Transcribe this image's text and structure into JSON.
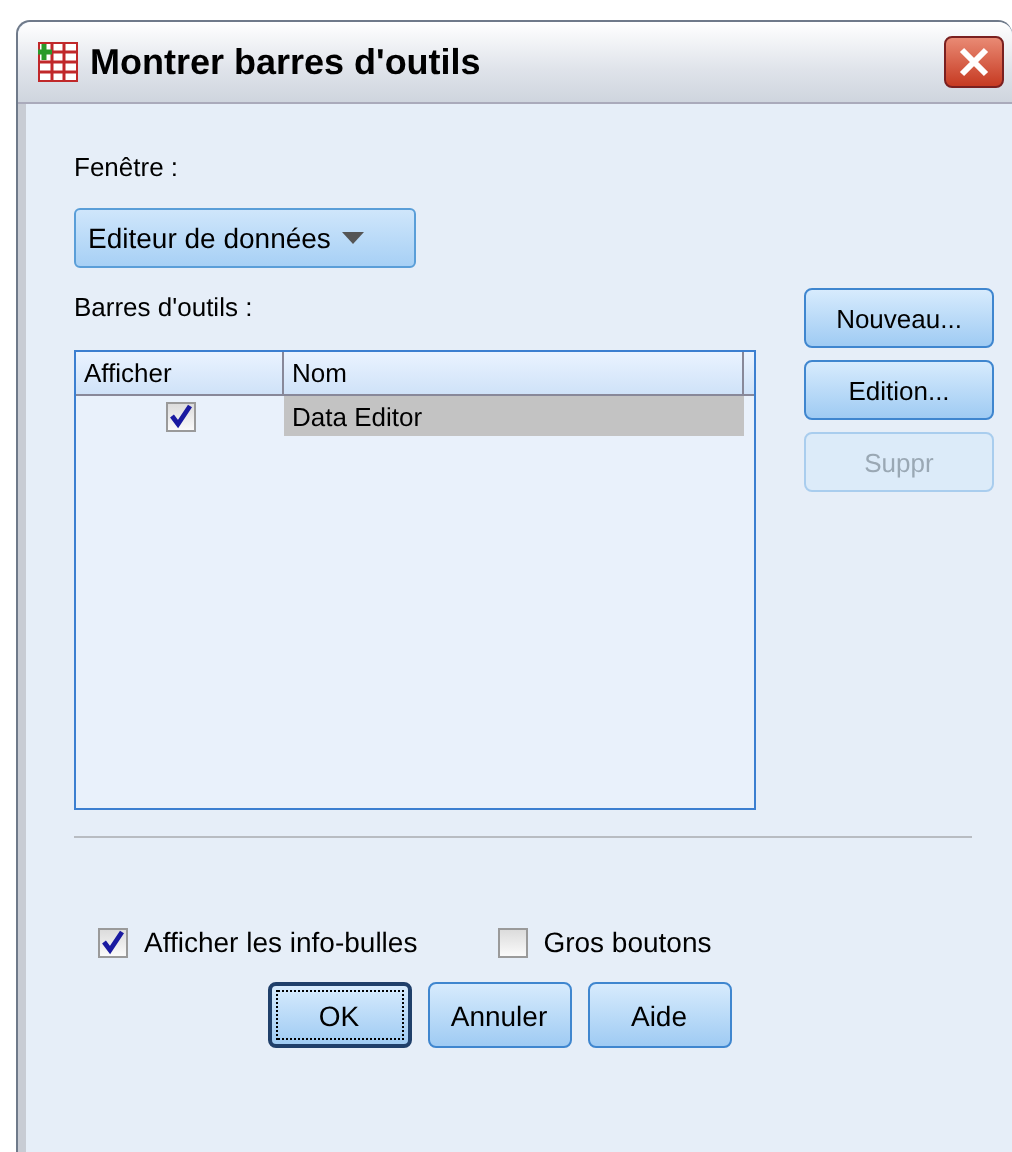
{
  "window": {
    "title": "Montrer barres d'outils"
  },
  "window_label": "Fenêtre :",
  "window_select": {
    "value": "Editeur de données"
  },
  "toolbars_label": "Barres d'outils :",
  "table": {
    "columns": [
      "Afficher",
      "Nom"
    ],
    "rows": [
      {
        "shown": true,
        "name": "Data Editor",
        "selected": true
      }
    ]
  },
  "side_buttons": [
    {
      "label": "Nouveau...",
      "disabled": false
    },
    {
      "label": "Edition...",
      "disabled": false
    },
    {
      "label": "Suppr",
      "disabled": true
    }
  ],
  "options": [
    {
      "label": "Afficher les info-bulles",
      "checked": true
    },
    {
      "label": "Gros boutons",
      "checked": false
    }
  ],
  "buttons": [
    {
      "label": "OK",
      "default": true
    },
    {
      "label": "Annuler",
      "default": false
    },
    {
      "label": "Aide",
      "default": false
    }
  ]
}
